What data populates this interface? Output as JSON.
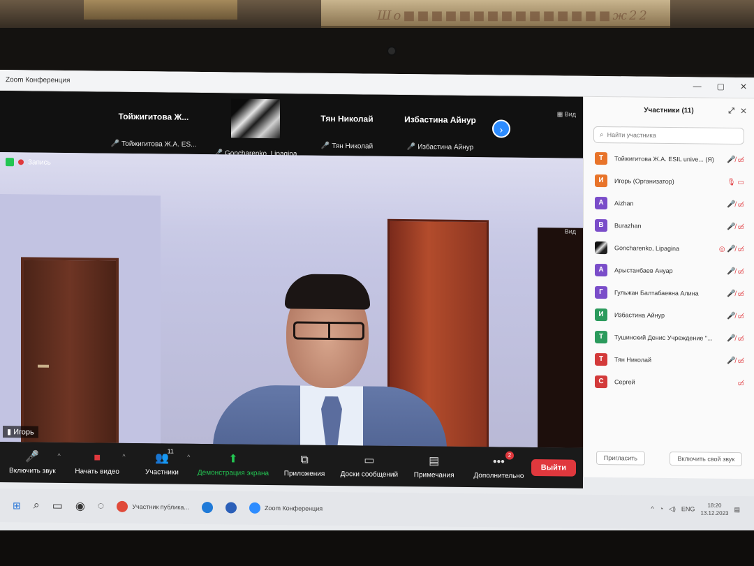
{
  "window": {
    "title": "Zoom Конференция"
  },
  "wall_text": "Шо■■■■■■■■■■■■■■■ж22",
  "strip": {
    "tiles": [
      {
        "name": "Тойжигитова Ж...",
        "sub": "Тойжигитова Ж.А. ES..."
      },
      {
        "name": "",
        "sub": "Goncharenko, Lipagina"
      },
      {
        "name": "Тян Николай",
        "sub": "Тян Николай"
      },
      {
        "name": "Избастина Айнур",
        "sub": "Избастина Айнур"
      }
    ],
    "view_label": "Вид"
  },
  "main": {
    "record_label": "Запись",
    "speaker_name": "Игорь",
    "view_label": "Вид"
  },
  "toolbar": {
    "audio": "Включить звук",
    "video": "Начать видео",
    "participants": "Участники",
    "participants_count": "11",
    "share": "Демонстрация экрана",
    "apps": "Приложения",
    "whiteboards": "Доски сообщений",
    "notes": "Примечания",
    "more": "Дополнительно",
    "more_badge": "2",
    "leave": "Выйти"
  },
  "panel": {
    "title": "Участники (11)",
    "search_placeholder": "Найти участника",
    "participants": [
      {
        "initial": "Т",
        "color": "#e8742a",
        "name": "Тойжигитова Ж.А. ESIL unive... (Я)",
        "icons": "🎤̸ ▭̸"
      },
      {
        "initial": "И",
        "color": "#e8742a",
        "name": "Игорь (Организатор)",
        "icons": "🎙 ▭"
      },
      {
        "initial": "A",
        "color": "#7a4dc9",
        "name": "Aizhan",
        "icons": "🎤̸ ▭̸"
      },
      {
        "initial": "B",
        "color": "#7a4dc9",
        "name": "Burazhan",
        "icons": "🎤̸ ▭̸"
      },
      {
        "initial": "",
        "color": "",
        "name": "Goncharenko, Lipagina",
        "icons": "◎ 🎤̸ ▭̸"
      },
      {
        "initial": "А",
        "color": "#7a4dc9",
        "name": "Арыстанбаев Ануар",
        "icons": "🎤̸ ▭̸"
      },
      {
        "initial": "Г",
        "color": "#7a4dc9",
        "name": "Гульжан Балтабаевна Алина",
        "icons": "🎤̸ ▭̸"
      },
      {
        "initial": "И",
        "color": "#2b9a5c",
        "name": "Избастина Айнур",
        "icons": "🎤̸ ▭̸"
      },
      {
        "initial": "Т",
        "color": "#2b9a5c",
        "name": "Тушинский Денис Учреждение \"...",
        "icons": "🎤̸ ▭̸"
      },
      {
        "initial": "Т",
        "color": "#d33a3a",
        "name": "Тян Николай",
        "icons": "🎤̸ ▭̸"
      },
      {
        "initial": "С",
        "color": "#d33a3a",
        "name": "Сергей",
        "icons": "▭̸"
      }
    ],
    "invite": "Пригласить",
    "unmute": "Включить свой звук"
  },
  "taskbar": {
    "apps": [
      {
        "label": "Участник публика...",
        "color": "#e04a3a"
      },
      {
        "label": "",
        "color": "#1f7ad8"
      },
      {
        "label": "",
        "color": "#2b5fb8"
      },
      {
        "label": "Zoom Конференция",
        "color": "#2d8cff"
      }
    ],
    "lang": "ENG",
    "time": "18:20",
    "date": "13.12.2023"
  }
}
